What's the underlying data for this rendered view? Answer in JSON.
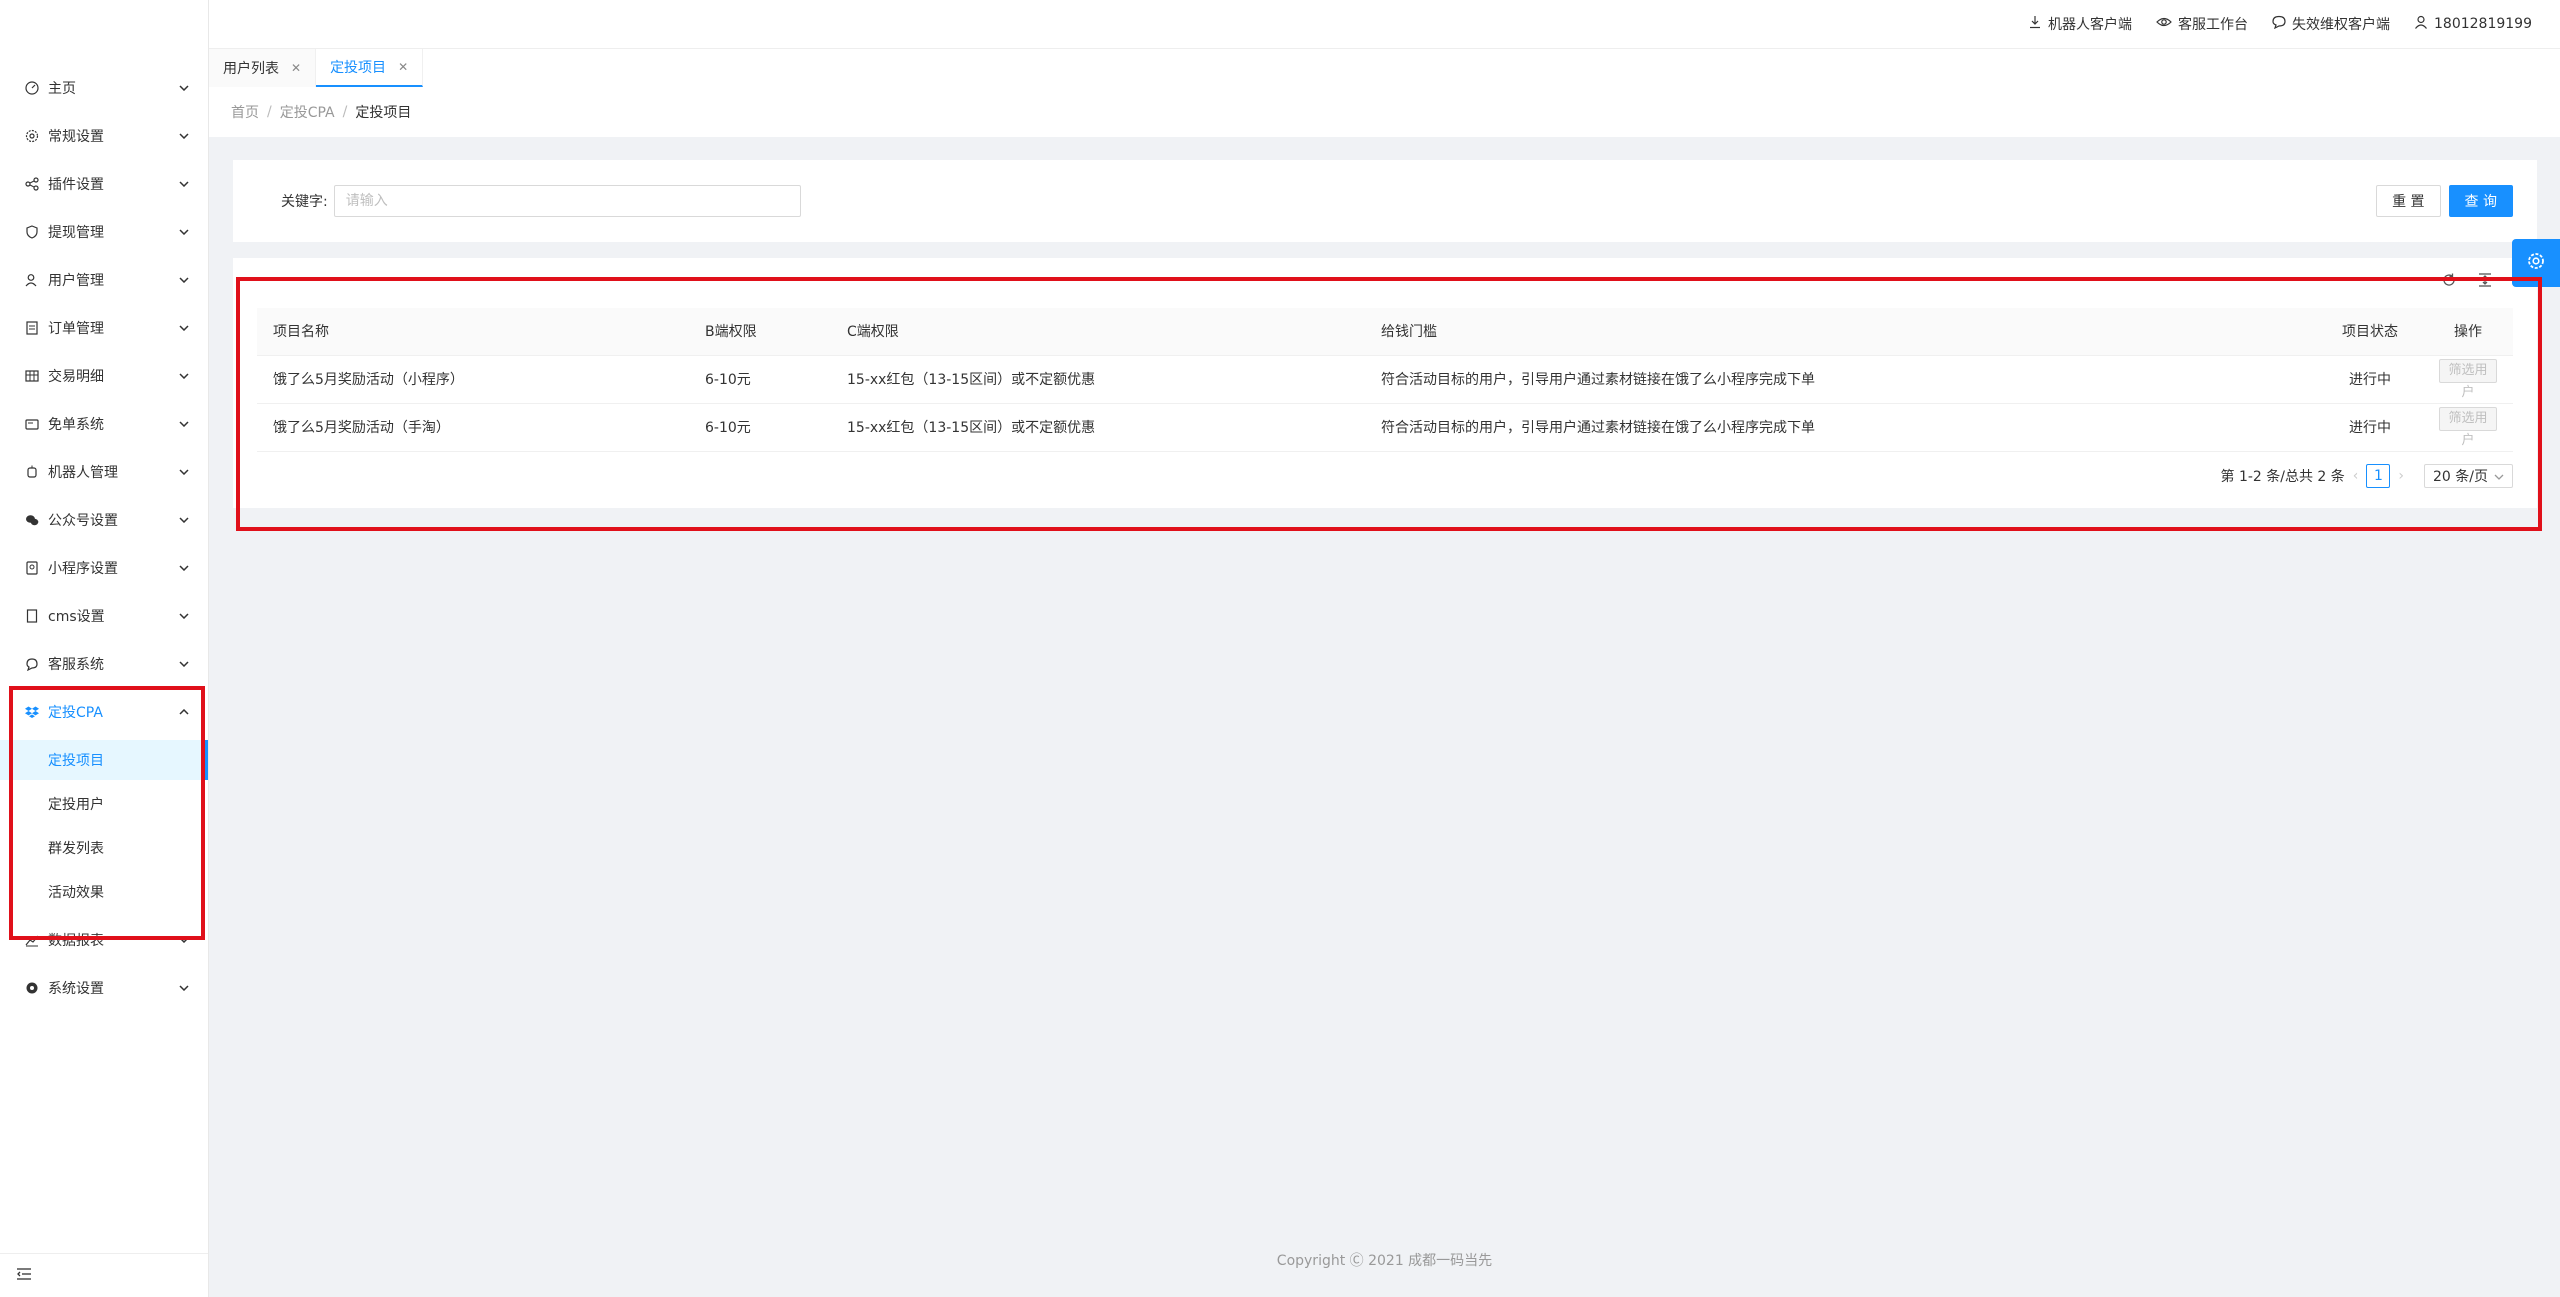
{
  "header": {
    "links": [
      {
        "label": "机器人客户端",
        "icon": "download-icon"
      },
      {
        "label": "客服工作台",
        "icon": "eye-icon"
      },
      {
        "label": "失效维权客户端",
        "icon": "chat-icon"
      },
      {
        "label": "18012819199",
        "icon": "user-icon"
      }
    ]
  },
  "sidebar": {
    "items": [
      {
        "label": "主页",
        "icon": "dashboard-icon"
      },
      {
        "label": "常规设置",
        "icon": "gear-icon"
      },
      {
        "label": "插件设置",
        "icon": "share-icon"
      },
      {
        "label": "提现管理",
        "icon": "shield-icon"
      },
      {
        "label": "用户管理",
        "icon": "user-icon"
      },
      {
        "label": "订单管理",
        "icon": "file-icon"
      },
      {
        "label": "交易明细",
        "icon": "table-icon"
      },
      {
        "label": "免单系统",
        "icon": "wallet-icon"
      },
      {
        "label": "机器人管理",
        "icon": "robot-icon"
      },
      {
        "label": "公众号设置",
        "icon": "wechat-icon"
      },
      {
        "label": "小程序设置",
        "icon": "miniprogram-icon"
      },
      {
        "label": "cms设置",
        "icon": "book-icon"
      },
      {
        "label": "客服系统",
        "icon": "service-icon"
      },
      {
        "label": "定投CPA",
        "icon": "dropbox-icon"
      }
    ],
    "sub_items": [
      {
        "label": "定投项目"
      },
      {
        "label": "定投用户"
      },
      {
        "label": "群发列表"
      },
      {
        "label": "活动效果"
      }
    ],
    "bottom_items": [
      {
        "label": "数据报表",
        "icon": "chart-icon"
      },
      {
        "label": "系统设置",
        "icon": "gear-icon"
      }
    ]
  },
  "tabs": [
    {
      "label": "用户列表"
    },
    {
      "label": "定投项目"
    }
  ],
  "breadcrumb": [
    "首页",
    "定投CPA",
    "定投项目"
  ],
  "search": {
    "label": "关键字:",
    "placeholder": "请输入",
    "reset_label": "重 置",
    "query_label": "查 询"
  },
  "table": {
    "columns": [
      "项目名称",
      "B端权限",
      "C端权限",
      "给钱门槛",
      "项目状态",
      "操作"
    ],
    "rows": [
      {
        "name": "饿了么5月奖励活动（小程序）",
        "b_perm": "6-10元",
        "c_perm": "15-xx红包（13-15区间）或不定额优惠",
        "threshold": "符合活动目标的用户，引导用户通过素材链接在饿了么小程序完成下单",
        "status": "进行中",
        "action": "筛选用户"
      },
      {
        "name": "饿了么5月奖励活动（手淘）",
        "b_perm": "6-10元",
        "c_perm": "15-xx红包（13-15区间）或不定额优惠",
        "threshold": "符合活动目标的用户，引导用户通过素材链接在饿了么小程序完成下单",
        "status": "进行中",
        "action": "筛选用户"
      }
    ]
  },
  "pagination": {
    "summary": "第 1-2 条/总共 2 条",
    "current_page": "1",
    "page_size": "20 条/页"
  },
  "footer": "Copyright Ⓒ 2021 成都一码当先",
  "colors": {
    "accent": "#1890ff",
    "annotation": "#e0101a"
  }
}
